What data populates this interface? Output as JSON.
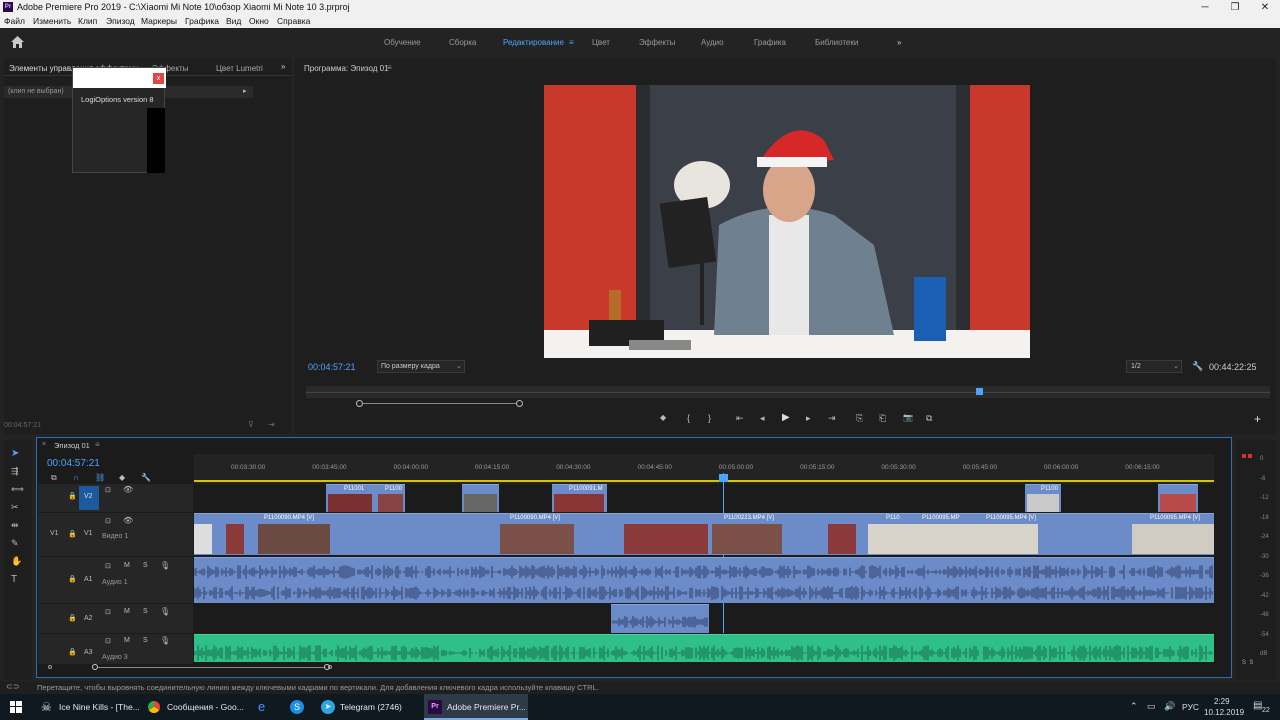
{
  "window": {
    "title": "Adobe Premiere Pro 2019 - C:\\Xiaomi Mi Note 10\\обзор Xiaomi Mi Note 10 3.prproj",
    "minimize_glyph": "─",
    "maximize_glyph": "❐",
    "close_glyph": "✕"
  },
  "menu": [
    "Файл",
    "Изменить",
    "Клип",
    "Эпизод",
    "Маркеры",
    "Графика",
    "Вид",
    "Окно",
    "Справка"
  ],
  "workspaces": {
    "items": [
      "Обучение",
      "Сборка",
      "Редактирование",
      "Цвет",
      "Эффекты",
      "Аудио",
      "Графика",
      "Библиотеки"
    ],
    "active": "Редактирование",
    "more_glyph": "»"
  },
  "left_panel": {
    "tabs": [
      "Элементы управления эффектами",
      "Эффекты",
      "Цвет Lumetri"
    ],
    "no_clip": "(клип не выбран)",
    "timecode": "00:04:57:21",
    "popup": {
      "text": "LogiOptions version 8",
      "close": "x"
    }
  },
  "program_monitor": {
    "title": "Программа: Эпизод 01",
    "current_timecode": "00:04:57:21",
    "fit": "По размеру кадра",
    "resolution": "1/2",
    "duration": "00:44:22:25",
    "playhead_fraction": 0.7,
    "transport": [
      "◆",
      "{",
      "}",
      "⇤",
      "◂",
      "▶",
      "▸",
      "⇥",
      "⎘",
      "⎗",
      "📷",
      "⧉"
    ],
    "add_glyph": "+"
  },
  "timeline": {
    "tab": "Эпизод 01",
    "timecode": "00:04:57:21",
    "ruler": [
      "00:03:30:00",
      "00:03:45:00",
      "00:04:00:00",
      "00:04:15:00",
      "00:04:30:00",
      "00:04:45:00",
      "00:05:00:00",
      "00:05:15:00",
      "00:05:30:00",
      "00:05:45:00",
      "00:06:00:00",
      "00:06:15:00"
    ],
    "tracks": {
      "v2": {
        "left": "V2",
        "right": "V2"
      },
      "v1": {
        "left": "V1",
        "right": "V1",
        "name": "Видео 1"
      },
      "a1": {
        "left": "A1",
        "name": "Аудио 1",
        "m": "M",
        "s": "S"
      },
      "a2": {
        "left": "A2",
        "m": "M",
        "s": "S"
      },
      "a3": {
        "left": "A3",
        "name": "Аудио 3",
        "m": "M",
        "s": "S"
      }
    },
    "v2_clips": [
      "P11001",
      "P1100",
      "P1100091.M",
      "P1100"
    ],
    "v1_clips": [
      "P1100090.MP4 [V]",
      "P1100090.MP4 [V]",
      "P1100223.MP4 [V]",
      "P110",
      "P1100095.MP",
      "P1100095.MP4 [V]",
      "P1100095.MP4 [V]"
    ],
    "meter_labels": [
      "0",
      "-6",
      "-12",
      "-18",
      "-24",
      "-30",
      "-36",
      "-42",
      "-48",
      "-54",
      "dB"
    ],
    "meter_ss": "S  S"
  },
  "status_bar": "Перетащите, чтобы выровнять соединительную линию между ключевыми кадрами по вертикали. Для добавления ключевого кадра используйте клавишу CTRL.",
  "taskbar": {
    "items": [
      "Ice Nine Kills - [The...",
      "Сообщения - Goo...",
      "Telegram (2746)",
      "Adobe Premiere Pr..."
    ],
    "lang": "РУС",
    "time": "2:29",
    "date": "10.12.2019",
    "notif": "22"
  },
  "colors": {
    "accent": "#4ea3ff",
    "video_clip": "#6c8cc9",
    "audio3_clip": "#2fc08a",
    "playhead": "#4ea3ff"
  }
}
